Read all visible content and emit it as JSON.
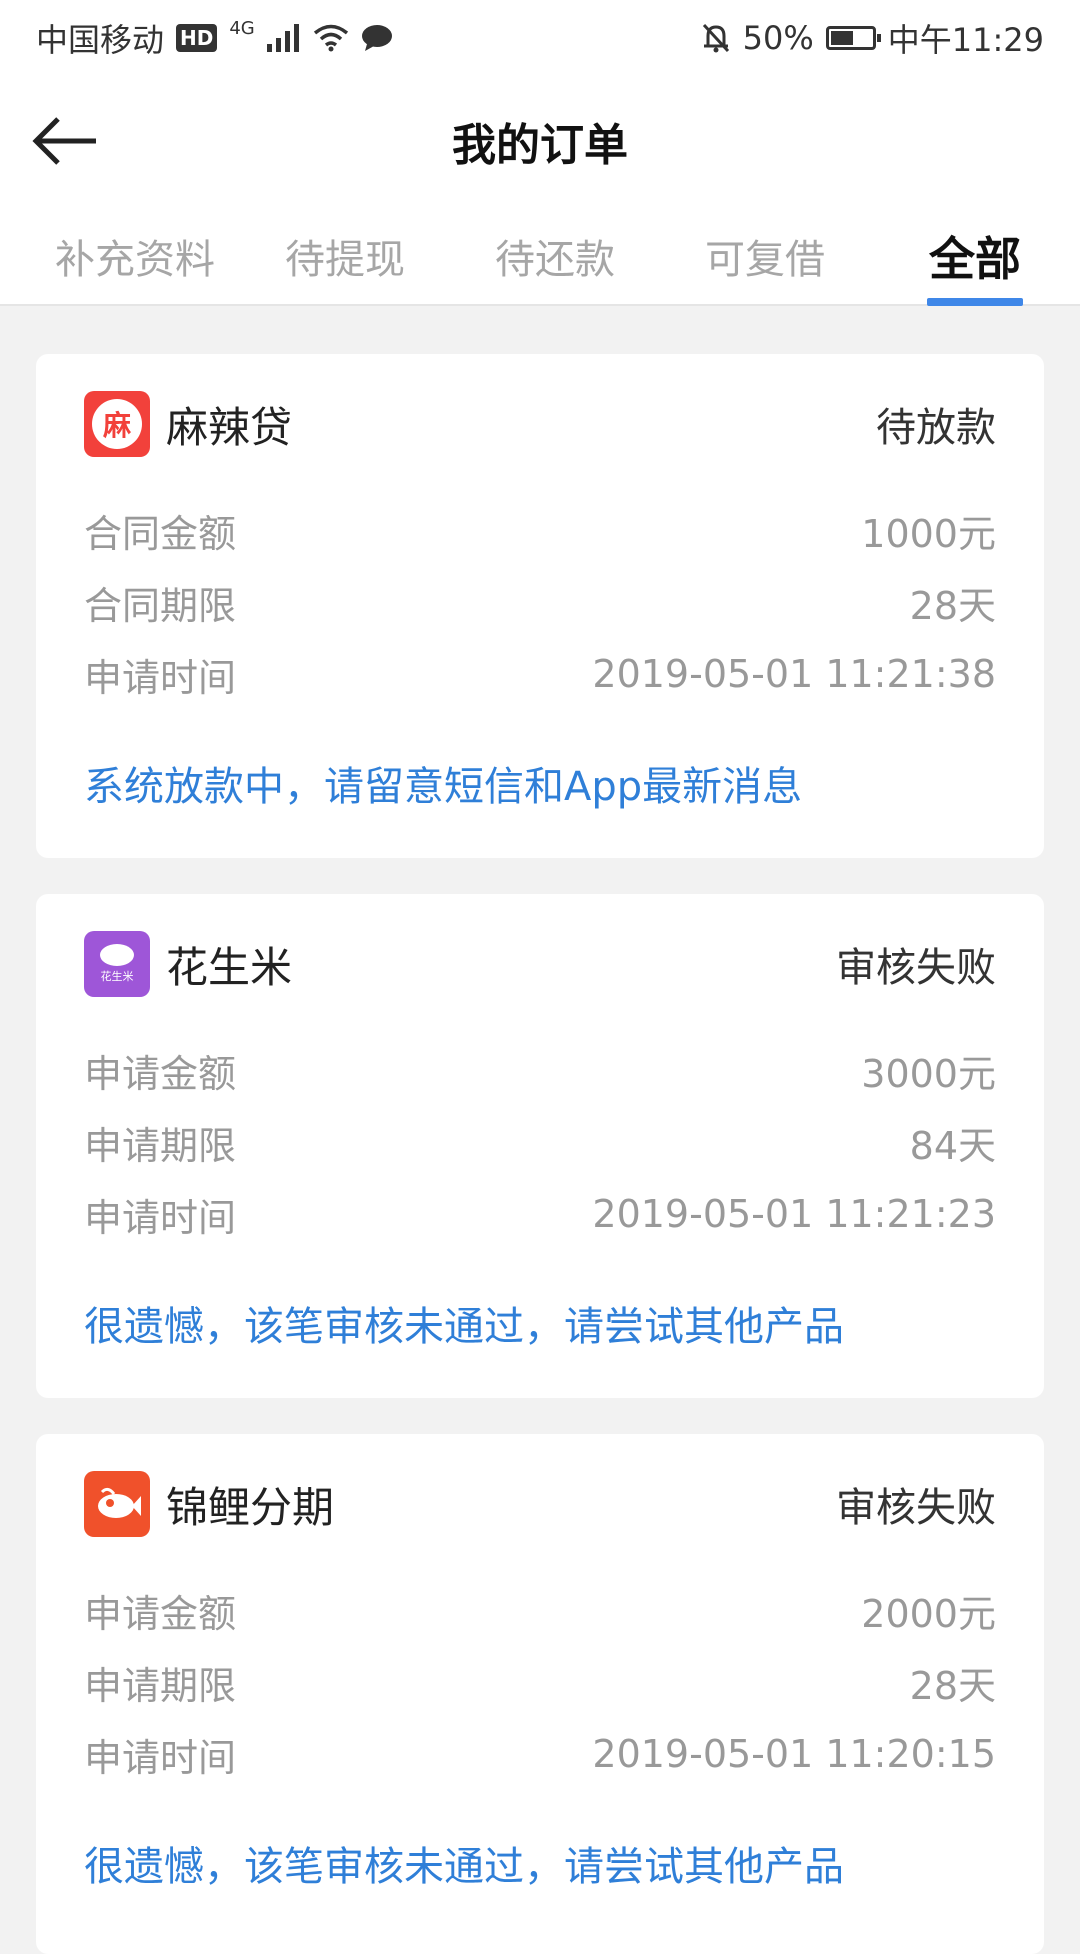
{
  "status_bar": {
    "carrier": "中国移动",
    "hd": "HD",
    "network": "4G",
    "battery": "50%",
    "time": "中午11:29"
  },
  "header": {
    "title": "我的订单",
    "back_icon": "back-arrow-icon"
  },
  "tabs": [
    {
      "label": "补充资料"
    },
    {
      "label": "待提现"
    },
    {
      "label": "待还款"
    },
    {
      "label": "可复借"
    },
    {
      "label": "全部",
      "active": true
    }
  ],
  "orders": [
    {
      "logo_text": "麻",
      "logo_color": "#f2413b",
      "name": "麻辣贷",
      "status": "待放款",
      "rows": [
        {
          "label": "合同金额",
          "value": "1000元"
        },
        {
          "label": "合同期限",
          "value": "28天"
        },
        {
          "label": "申请时间",
          "value": "2019-05-01 11:21:38"
        }
      ],
      "notice": "系统放款中，请留意短信和App最新消息"
    },
    {
      "logo_text": "花生米",
      "logo_color": "#9e56d8",
      "name": "花生米",
      "status": "审核失败",
      "rows": [
        {
          "label": "申请金额",
          "value": "3000元"
        },
        {
          "label": "申请期限",
          "value": "84天"
        },
        {
          "label": "申请时间",
          "value": "2019-05-01 11:21:23"
        }
      ],
      "notice": "很遗憾，该笔审核未通过，请尝试其他产品"
    },
    {
      "logo_text": "",
      "logo_color": "#f0512b",
      "name": "锦鲤分期",
      "status": "审核失败",
      "rows": [
        {
          "label": "申请金额",
          "value": "2000元"
        },
        {
          "label": "申请期限",
          "value": "28天"
        },
        {
          "label": "申请时间",
          "value": "2019-05-01 11:20:15"
        }
      ],
      "notice": "很遗憾，该笔审核未通过，请尝试其他产品"
    }
  ],
  "colors": {
    "accent": "#3f87e8",
    "notice": "#2f7fd8",
    "muted": "#999999"
  }
}
